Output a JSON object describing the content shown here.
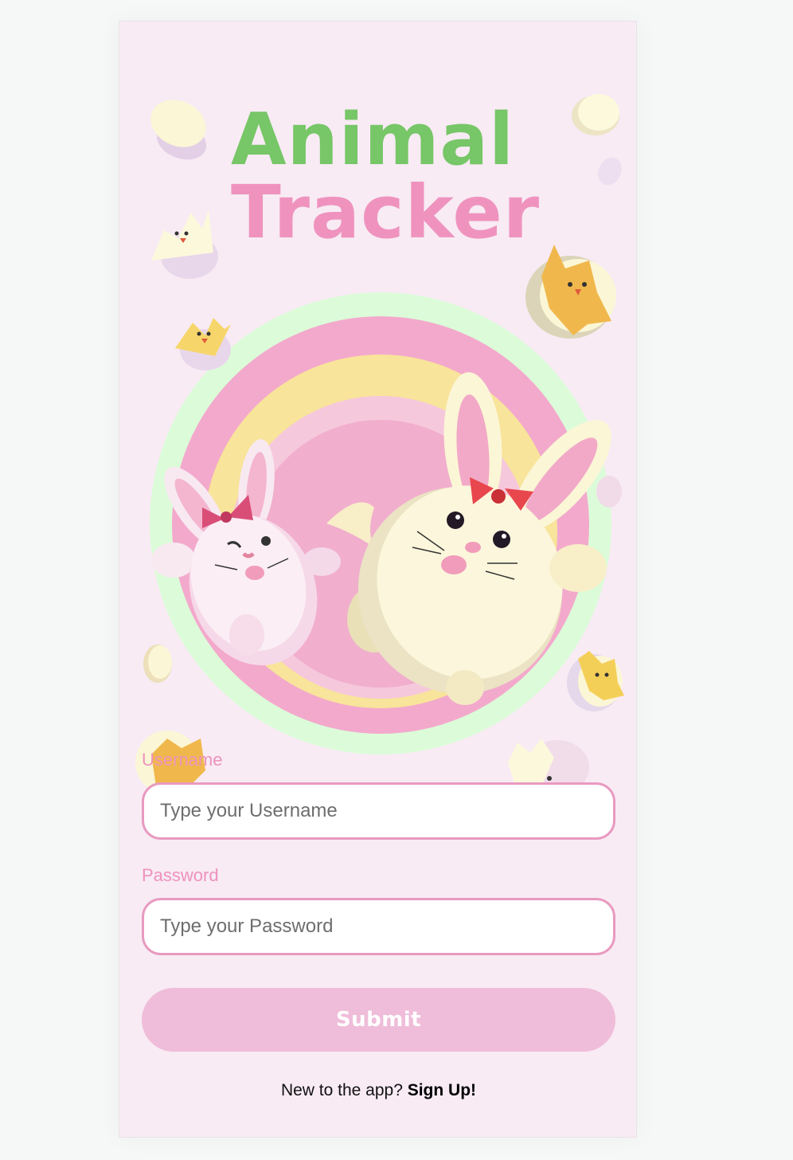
{
  "app": {
    "title_line1": "Animal",
    "title_line2": "Tracker"
  },
  "form": {
    "username_label": "Username",
    "username_placeholder": "Type your Username",
    "username_value": "",
    "password_label": "Password",
    "password_placeholder": "Type your Password",
    "password_value": "",
    "submit_label": "Submit"
  },
  "footer": {
    "prompt": "New to the app? ",
    "signup_label": "Sign Up!"
  },
  "illustration": {
    "subject": "two-bunnies-with-bows-in-rainbow-circle",
    "decor": [
      "egg-icon",
      "hatching-chick-icon"
    ]
  },
  "colors": {
    "background": "#f6f8f7",
    "card": "#f8ebf4",
    "title_green": "#77c667",
    "title_pink": "#ef93be",
    "label_pink": "#ee92bd",
    "input_border": "#e89ac0",
    "button_pink": "#efbdd9"
  }
}
